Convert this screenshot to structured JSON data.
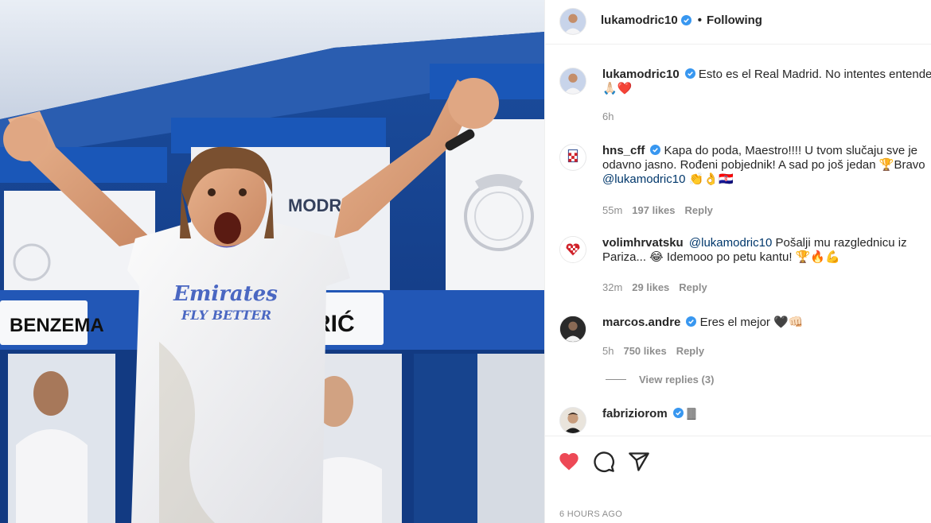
{
  "post": {
    "author": "lukamodric10",
    "follow_status": "Following",
    "separator": "•",
    "caption": "Esto es el Real Madrid. No intentes entenderlo",
    "caption_emoji": "🙏🏻❤️",
    "caption_time": "6h",
    "timestamp": "6 HOURS AGO",
    "liked": true
  },
  "photo": {
    "locker_name_left": "BENZEMA",
    "locker_name_right": "RIĆ",
    "jersey_name": "MODRIĆ",
    "shirt_sponsor_line1": "Emirates",
    "shirt_sponsor_line2": "FLY BETTER"
  },
  "comments": [
    {
      "user": "hns_cff",
      "verified": true,
      "text": "Kapa do poda, Maestro!!!! U tvom slučaju sve je odavno jasno. Rođeni pobjednik! A sad po još jedan 🏆Bravo ",
      "mention": "@lukamodric10",
      "tail": " 👏👌🇭🇷",
      "time": "55m",
      "likes": "197 likes",
      "reply": "Reply"
    },
    {
      "user": "volimhrvatsku",
      "verified": false,
      "mention": "@lukamodric10",
      "text": " Pošalji mu razglednicu iz Pariza... 😂 Idemooo po petu kantu! 🏆🔥💪",
      "time": "32m",
      "likes": "29 likes",
      "reply": "Reply"
    },
    {
      "user": "marcos.andre",
      "verified": true,
      "text": "Eres el mejor 🖤👊🏻",
      "time": "5h",
      "likes": "750 likes",
      "reply": "Reply",
      "view_replies": "View replies (3)"
    },
    {
      "user": "fabriziorom",
      "verified": true,
      "text": "🀫"
    }
  ],
  "colors": {
    "accent_red": "#ed4956",
    "verified_blue": "#3897f0",
    "link": "#00376b",
    "muted": "#8e8e8e"
  }
}
